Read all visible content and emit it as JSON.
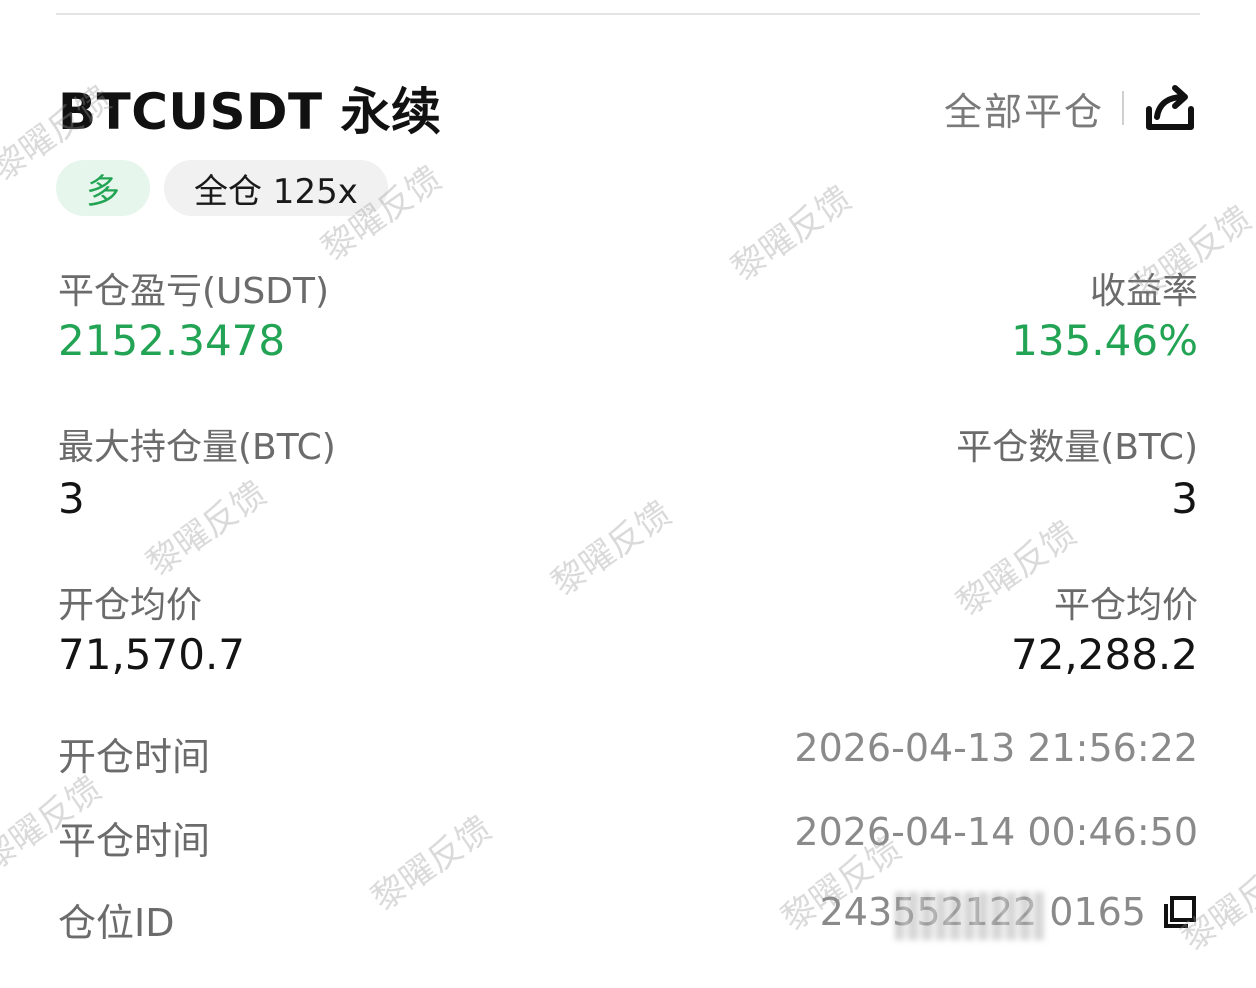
{
  "header": {
    "title": "BTCUSDT 永续",
    "close_all_label": "全部平仓",
    "share_icon": "share-icon"
  },
  "tags": {
    "direction": "多",
    "margin_mode": "全仓 125x"
  },
  "colors": {
    "profit_green": "#23a455",
    "tag_green_bg": "#e6f6ec",
    "label_gray": "#6b6b6b",
    "value_gray": "#8a8a8a"
  },
  "stats": {
    "pnl_label": "平仓盈亏(USDT)",
    "pnl_value": "2152.3478",
    "roi_label": "收益率",
    "roi_value": "135.46%",
    "max_pos_label": "最大持仓量(BTC)",
    "max_pos_value": "3",
    "close_qty_label": "平仓数量(BTC)",
    "close_qty_value": "3",
    "open_avg_label": "开仓均价",
    "open_avg_value": "71,570.7",
    "close_avg_label": "平仓均价",
    "close_avg_value": "72,288.2"
  },
  "details": {
    "open_time_label": "开仓时间",
    "open_time_value": "2026-04-13 21:56:22",
    "close_time_label": "平仓时间",
    "close_time_value": "2026-04-14 00:46:50",
    "position_id_label": "仓位ID",
    "position_id_value": "243552122      0165",
    "copy_icon": "copy-icon"
  },
  "watermark": {
    "text": "黎曜反馈"
  }
}
